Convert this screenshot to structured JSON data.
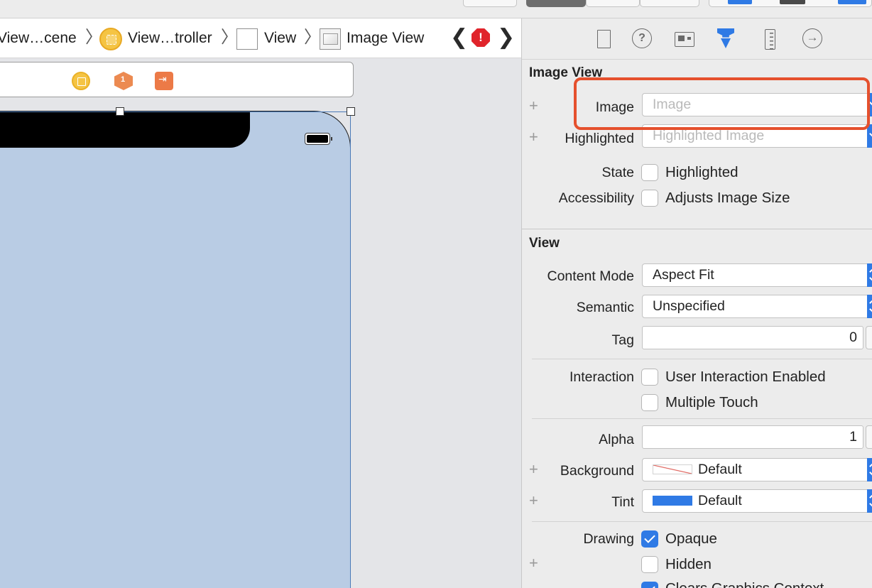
{
  "breadcrumb": {
    "scene": "View…cene",
    "controller": "View…troller",
    "view": "View",
    "image_view": "Image View"
  },
  "nav": {
    "back_glyph": "❮",
    "forward_glyph": "❯",
    "issue_glyph": "!"
  },
  "inspector": {
    "tab_connections_glyph": "→",
    "tab_help_glyph": "?",
    "image_view": {
      "title": "Image View",
      "image_label": "Image",
      "image_placeholder": "Image",
      "highlighted_label": "Highlighted",
      "highlighted_placeholder": "Highlighted Image",
      "state_label": "State",
      "state_option": "Highlighted",
      "state_checked": false,
      "accessibility_label": "Accessibility",
      "accessibility_option": "Adjusts Image Size",
      "accessibility_checked": false
    },
    "view": {
      "title": "View",
      "content_mode_label": "Content Mode",
      "content_mode_value": "Aspect Fit",
      "semantic_label": "Semantic",
      "semantic_value": "Unspecified",
      "tag_label": "Tag",
      "tag_value": "0",
      "interaction_label": "Interaction",
      "interaction_option_1": "User Interaction Enabled",
      "interaction_option_2": "Multiple Touch",
      "alpha_label": "Alpha",
      "alpha_value": "1",
      "background_label": "Background",
      "background_value": "Default",
      "tint_label": "Tint",
      "tint_value": "Default",
      "tint_color": "#2f7ae5",
      "drawing_label": "Drawing",
      "drawing_option_1": "Opaque",
      "drawing_option_2": "Hidden",
      "drawing_option_3": "Clears Graphics Context"
    },
    "plus_glyph": "+"
  },
  "colors": {
    "accent": "#2f7ae5",
    "canvas_device": "#b9cce4",
    "highlight_annotation": "#e5502d"
  }
}
